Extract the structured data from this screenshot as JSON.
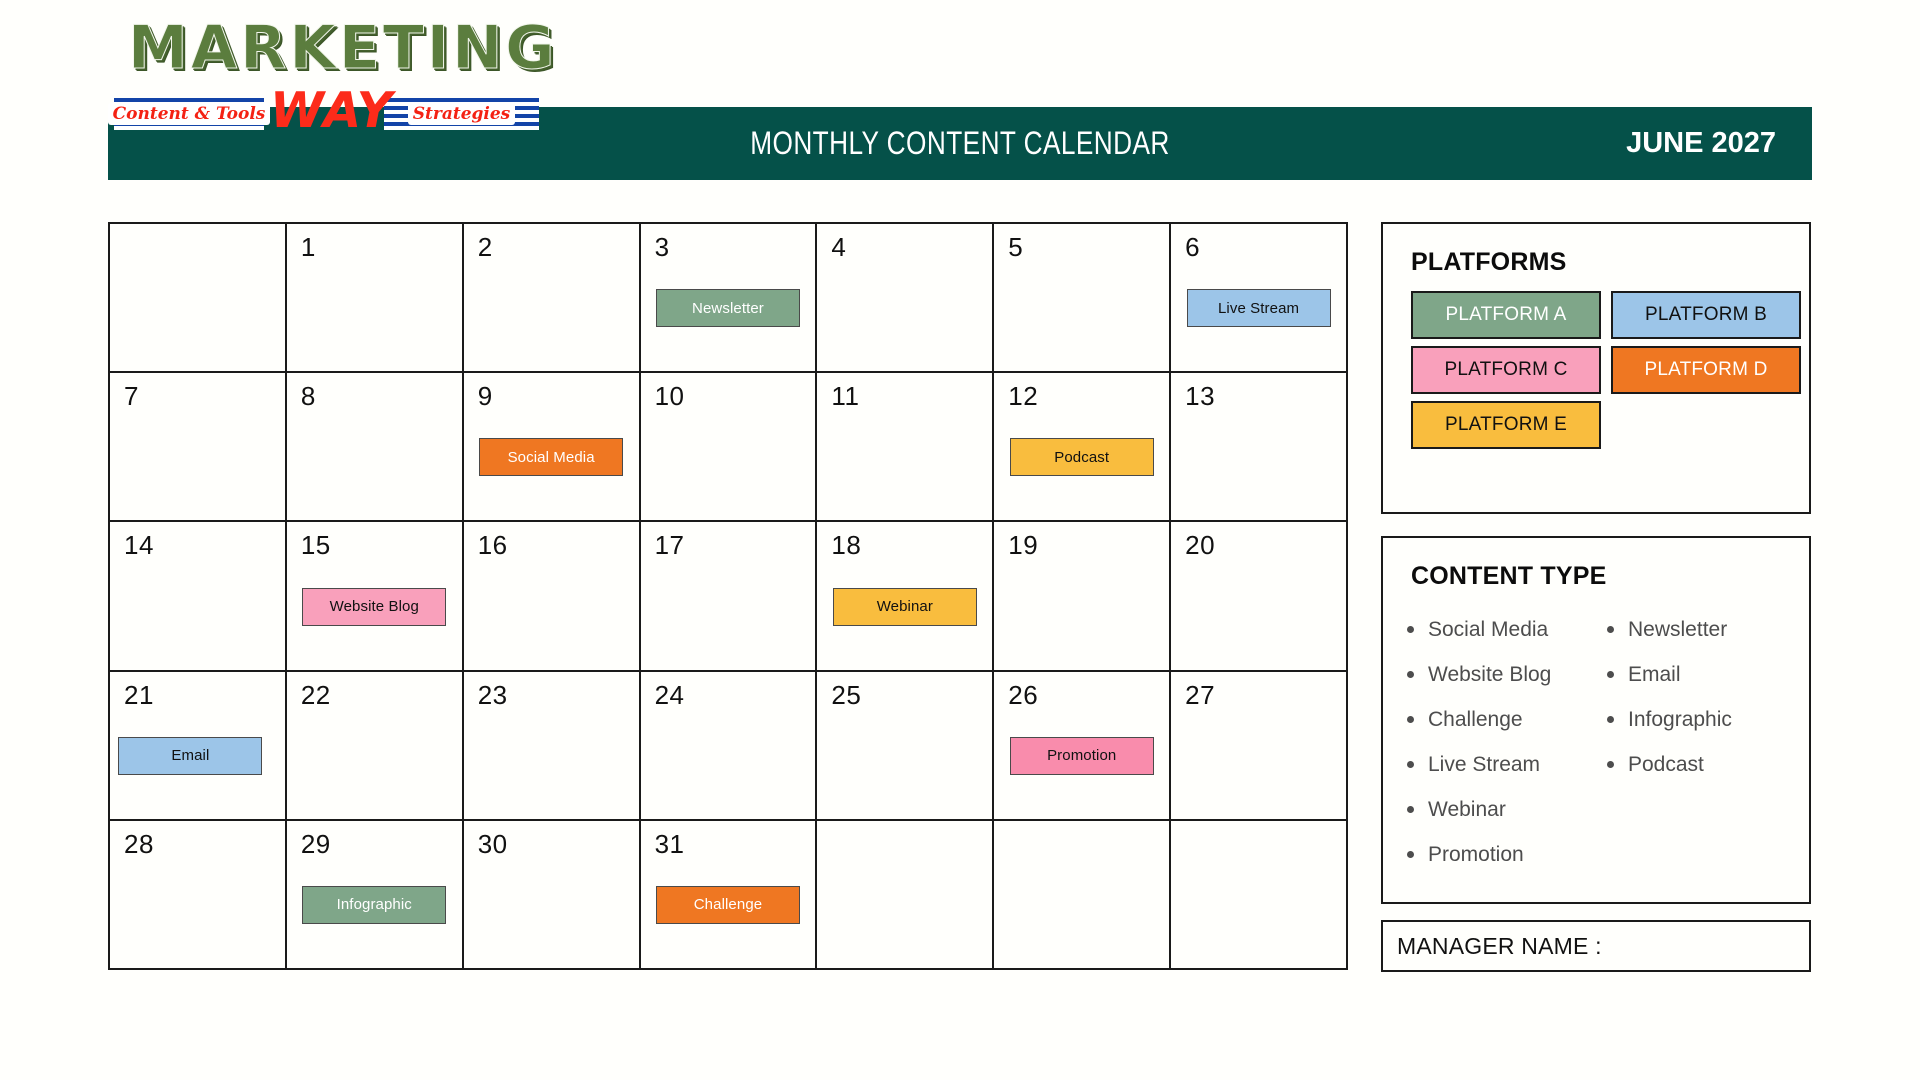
{
  "logo": {
    "wordmark": "MARKETING",
    "way": "WAY",
    "left_tag": "Content & Tools",
    "right_tag": "Strategies"
  },
  "header": {
    "title": "MONTHLY CONTENT CALENDAR",
    "month": "JUNE 2027",
    "bar_color": "#055149"
  },
  "calendar": {
    "cells": [
      {
        "day": "",
        "event": null
      },
      {
        "day": "1",
        "event": null
      },
      {
        "day": "2",
        "event": null
      },
      {
        "day": "3",
        "event": {
          "label": "Newsletter",
          "bg": "#7fa689",
          "fg": "#ffffff"
        }
      },
      {
        "day": "4",
        "event": null
      },
      {
        "day": "5",
        "event": null
      },
      {
        "day": "6",
        "event": {
          "label": "Live Stream",
          "bg": "#9cc5e8",
          "fg": "#111111"
        }
      },
      {
        "day": "7",
        "event": null
      },
      {
        "day": "8",
        "event": null
      },
      {
        "day": "9",
        "event": {
          "label": "Social Media",
          "bg": "#ef7722",
          "fg": "#ffffff"
        }
      },
      {
        "day": "10",
        "event": null
      },
      {
        "day": "11",
        "event": null
      },
      {
        "day": "12",
        "event": {
          "label": "Podcast",
          "bg": "#f9bd3e",
          "fg": "#111111"
        }
      },
      {
        "day": "13",
        "event": null
      },
      {
        "day": "14",
        "event": null
      },
      {
        "day": "15",
        "event": {
          "label": "Website Blog",
          "bg": "#f9a0bb",
          "fg": "#111111"
        }
      },
      {
        "day": "16",
        "event": null
      },
      {
        "day": "17",
        "event": null
      },
      {
        "day": "18",
        "event": {
          "label": "Webinar",
          "bg": "#f9bd3e",
          "fg": "#111111"
        }
      },
      {
        "day": "19",
        "event": null
      },
      {
        "day": "20",
        "event": null
      },
      {
        "day": "21",
        "event": {
          "label": "Email",
          "bg": "#9cc5e8",
          "fg": "#111111",
          "offset": "left"
        }
      },
      {
        "day": "22",
        "event": null
      },
      {
        "day": "23",
        "event": null
      },
      {
        "day": "24",
        "event": null
      },
      {
        "day": "25",
        "event": null
      },
      {
        "day": "26",
        "event": {
          "label": "Promotion",
          "bg": "#f98cac",
          "fg": "#111111"
        }
      },
      {
        "day": "27",
        "event": null
      },
      {
        "day": "28",
        "event": null
      },
      {
        "day": "29",
        "event": {
          "label": "Infographic",
          "bg": "#7fa689",
          "fg": "#ffffff"
        }
      },
      {
        "day": "30",
        "event": null
      },
      {
        "day": "31",
        "event": {
          "label": "Challenge",
          "bg": "#ef7722",
          "fg": "#ffffff"
        }
      },
      {
        "day": "",
        "event": null
      },
      {
        "day": "",
        "event": null
      },
      {
        "day": "",
        "event": null
      }
    ]
  },
  "platforms": {
    "heading": "PLATFORMS",
    "items": [
      {
        "label": "PLATFORM A",
        "bg": "#7fa689",
        "fg": "#ffffff"
      },
      {
        "label": "PLATFORM B",
        "bg": "#9cc5e8",
        "fg": "#111111"
      },
      {
        "label": "PLATFORM C",
        "bg": "#f9a0bb",
        "fg": "#111111"
      },
      {
        "label": "PLATFORM D",
        "bg": "#ef7722",
        "fg": "#ffffff"
      },
      {
        "label": "PLATFORM E",
        "bg": "#f9bd3e",
        "fg": "#111111"
      }
    ]
  },
  "content_type": {
    "heading": "CONTENT TYPE",
    "column_left": [
      "Social Media",
      "Website Blog",
      "Challenge",
      "Live Stream",
      "Webinar",
      "Promotion"
    ],
    "column_right": [
      "Newsletter",
      "Email",
      "Infographic",
      "Podcast",
      "",
      ""
    ]
  },
  "manager": {
    "label": "MANAGER NAME :",
    "value": ""
  }
}
